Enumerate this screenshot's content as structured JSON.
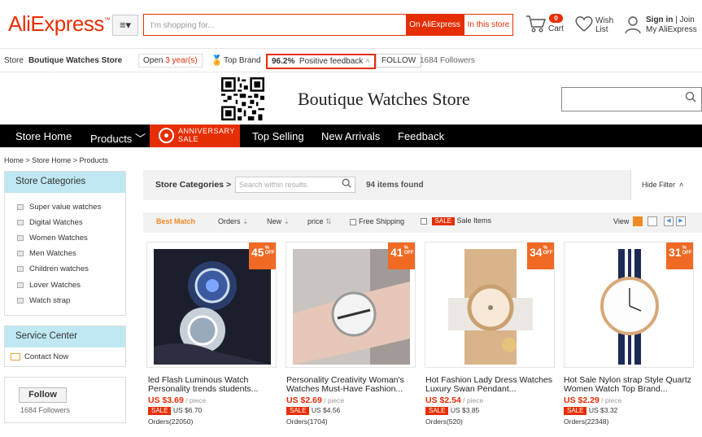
{
  "header": {
    "logo": "AliExpress",
    "logo_tm": "™",
    "menu_icon": "≡▾",
    "search_placeholder": "I'm shopping for...",
    "btn_ali": "On AliExpress",
    "btn_store": "In this store",
    "cart_count": "0",
    "cart_label": "Cart",
    "wish_line1": "Wish",
    "wish_line2": "List",
    "sign_in": "Sign in",
    "join": "Join",
    "my_ali": "My AliExpress"
  },
  "store_bar": {
    "store_label": "Store",
    "store_name": "Boutique Watches Store",
    "open_prefix": "Open ",
    "open_years": "3 year(s)",
    "top_brand": "Top Brand",
    "feedback_pct": "96.2%",
    "feedback_label": "Positive feedback",
    "follow": "FOLLOW",
    "followers": "1684 Followers"
  },
  "banner": {
    "title": "Boutique Watches Store"
  },
  "nav": {
    "home": "Store Home",
    "products": "Products",
    "anniv_line1": "ANNIVERSARY",
    "anniv_line2": "SALE",
    "top_selling": "Top Selling",
    "new_arrivals": "New Arrivals",
    "feedback": "Feedback"
  },
  "breadcrumb": "Home > Store Home > Products",
  "sidebar": {
    "categories_title": "Store Categories",
    "categories": [
      "Super value watches",
      "Digital Watches",
      "Women Watches",
      "Men Watches",
      "Children watches",
      "Lover Watches",
      "Watch strap"
    ],
    "service_title": "Service Center",
    "contact": "Contact Now",
    "follow_btn": "Follow",
    "follow_count": "1684 Followers"
  },
  "filter": {
    "label": "Store Categories >",
    "placeholder": "Search within results.",
    "items_found": "94 items found",
    "hide_filter": "Hide Filter"
  },
  "sort": {
    "best_match": "Best Match",
    "orders": "Orders",
    "new": "New",
    "price": "price",
    "free_shipping": "Free Shipping",
    "sale_tag": "SALE",
    "sale_items": "Sale Items",
    "view": "View"
  },
  "products": [
    {
      "discount": "45",
      "title": "led Flash Luminous Watch Personality trends students...",
      "price": "US $3.69",
      "unit": " / piece",
      "sale_tag": "SALE",
      "orig": "US $6.70",
      "orders": "Orders(22050)"
    },
    {
      "discount": "41",
      "title": "Personality Creativity Woman's Watches Must-Have Fashion...",
      "price": "US $2.69",
      "unit": " / piece",
      "sale_tag": "SALE",
      "orig": "US $4.56",
      "orders": "Orders(1704)"
    },
    {
      "discount": "34",
      "title": "Hot Fashion Lady Dress Watches Luxury Swan Pendant...",
      "price": "US $2.54",
      "unit": " / piece",
      "sale_tag": "SALE",
      "orig": "US $3.85",
      "orders": "Orders(520)"
    },
    {
      "discount": "31",
      "title": "Hot Sale Nylon strap Style Quartz Women Watch Top Brand...",
      "price": "US $2.29",
      "unit": " / piece",
      "sale_tag": "SALE",
      "orig": "US $3.32",
      "orders": "Orders(22348)"
    }
  ],
  "discount_pct": "%",
  "discount_off": "OFF",
  "colors": {
    "brand": "#e62e04",
    "accent": "#f08a24",
    "sidebar_head": "#bfe8f2",
    "nav": "#000000"
  }
}
